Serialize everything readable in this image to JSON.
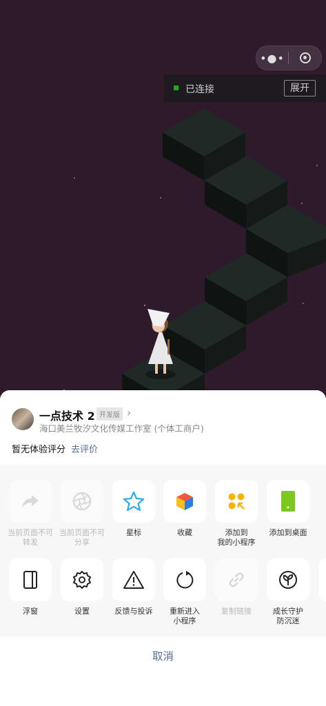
{
  "topbar": {
    "more_icon": "more-dots-icon",
    "close_icon": "close-circle-icon"
  },
  "connection": {
    "status": "已连接",
    "expand": "展开",
    "status_color": "#1aad19"
  },
  "miniprogram": {
    "name": "一点技术 2",
    "tag": "开发版",
    "company": "海口美兰牧汐文化传媒工作室 (个体工商户)",
    "rating_text": "暂无体验评分",
    "rate_link": "去评价"
  },
  "actions_row1": [
    {
      "label": "当前页面不可\n转发",
      "icon": "share-arrow-icon",
      "disabled": true
    },
    {
      "label": "当前页面不可\n分享",
      "icon": "shutter-icon",
      "disabled": true
    },
    {
      "label": "星标",
      "icon": "star-icon",
      "disabled": false
    },
    {
      "label": "收藏",
      "icon": "cube-icon",
      "disabled": false
    },
    {
      "label": "添加到\n我的小程序",
      "icon": "miniprogram-add-icon",
      "disabled": false
    },
    {
      "label": "添加到桌面",
      "icon": "phone-screen-icon",
      "disabled": false
    }
  ],
  "actions_row2": [
    {
      "label": "浮窗",
      "icon": "float-window-icon",
      "disabled": false
    },
    {
      "label": "设置",
      "icon": "gear-icon",
      "disabled": false
    },
    {
      "label": "反馈与投诉",
      "icon": "warning-triangle-icon",
      "disabled": false
    },
    {
      "label": "重新进入\n小程序",
      "icon": "reload-icon",
      "disabled": false
    },
    {
      "label": "复制链接",
      "icon": "link-icon",
      "disabled": true
    },
    {
      "label": "成长守护\n防沉迷",
      "icon": "sprout-icon",
      "disabled": false
    }
  ],
  "cancel": "取消",
  "colors": {
    "link": "#576b95",
    "game_bg": "#2f1a2c",
    "block": "#1f2a26"
  }
}
